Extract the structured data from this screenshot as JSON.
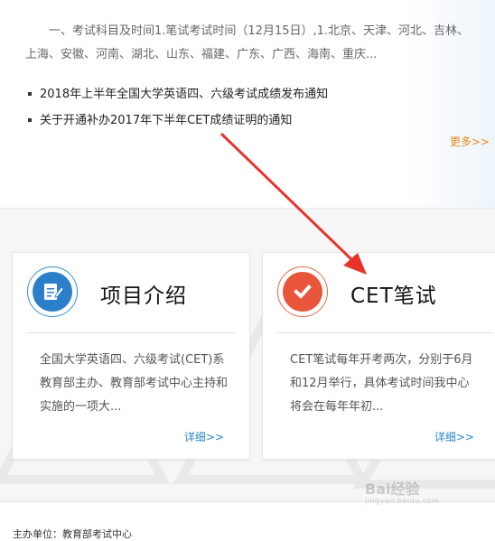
{
  "intro": {
    "text": "一、考试科目及时间1.笔试考试时间（12月15日）,1.北京、天津、河北、吉林、上海、安徽、河南、湖北、山东、福建、广东、广西、海南、重庆..."
  },
  "news": [
    {
      "title": "2018年上半年全国大学英语四、六级考试成绩发布通知"
    },
    {
      "title": "关于开通补办2017年下半年CET成绩证明的通知"
    }
  ],
  "news_more": "更多>>",
  "cards": [
    {
      "title": "项目介绍",
      "icon": "document-edit-icon",
      "description": "全国大学英语四、六级考试(CET)系教育部主办、教育部考试中心主持和实施的一项大...",
      "more": "详细>>"
    },
    {
      "title": "CET笔试",
      "icon": "checkmark-icon",
      "description": "CET笔试每年开考两次，分别于6月和12月举行，具体考试时间我中心将会在每年年初...",
      "more": "详细>>"
    }
  ],
  "footer": {
    "text": "主办单位：教育部考试中心"
  },
  "watermark": {
    "brand": "Bai经验",
    "sub": "jingyan.baidu.com"
  },
  "colors": {
    "accent_blue": "#2b7fc8",
    "accent_red": "#e8553a",
    "more_orange": "#e88a1a",
    "annotation_arrow": "#e8332a"
  }
}
